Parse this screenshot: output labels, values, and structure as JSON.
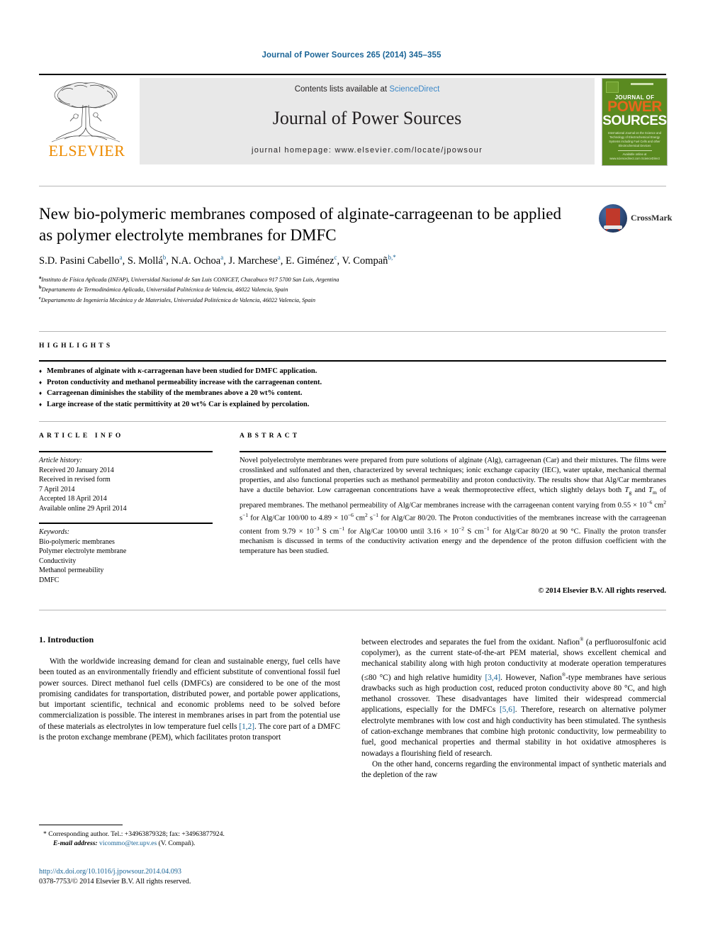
{
  "journal_ref": "Journal of Power Sources 265 (2014) 345–355",
  "masthead": {
    "contents_prefix": "Contents lists available at ",
    "sciencedirect": "ScienceDirect",
    "journal_title": "Journal of Power Sources",
    "homepage": "journal homepage: www.elsevier.com/locate/jpowsour",
    "publisher": "ELSEVIER",
    "cover": {
      "line1": "JOURNAL OF",
      "line2": "POWER",
      "line3": "SOURCES",
      "blurb": "International Journal on the Science and Technology of Electrochemical Energy Systems including Fuel Cells and other Electrochemical Devices",
      "foot": "Available online at www.sciencedirect.com ScienceDirect"
    }
  },
  "article": {
    "title": "New bio-polymeric membranes composed of alginate-carrageenan to be applied as polymer electrolyte membranes for DMFC",
    "crossmark_label": "CrossMark",
    "authors": [
      {
        "name": "S.D. Pasini Cabello",
        "marks": "a"
      },
      {
        "name": "S. Mollá",
        "marks": "b"
      },
      {
        "name": "N.A. Ochoa",
        "marks": "a"
      },
      {
        "name": "J. Marchese",
        "marks": "a"
      },
      {
        "name": "E. Giménez",
        "marks": "c"
      },
      {
        "name": "V. Compañ",
        "marks": "b,*"
      }
    ],
    "affiliations": [
      {
        "mark": "a",
        "text": "Instituto de Física Aplicada (INFAP), Universidad Nacional de San Luis CONICET, Chacabuco 917 5700 San Luis, Argentina"
      },
      {
        "mark": "b",
        "text": "Departamento de Termodinámica Aplicada, Universidad Politécnica de Valencia, 46022 Valencia, Spain"
      },
      {
        "mark": "c",
        "text": "Departamento de Ingeniería Mecánica y de Materiales, Universidad Politécnica de Valencia, 46022 Valencia, Spain"
      }
    ]
  },
  "highlights": {
    "heading": "HIGHLIGHTS",
    "items": [
      {
        "pre": "Membranes of alginate with ",
        "italic": "κ",
        "post": "-carrageenan have been studied for DMFC application."
      },
      {
        "pre": "Proton conductivity and methanol permeability increase with the carrageenan content.",
        "italic": "",
        "post": ""
      },
      {
        "pre": "Carrageenan diminishes the stability of the membranes above a 20 wt% content.",
        "italic": "",
        "post": ""
      },
      {
        "pre": "Large increase of the static permittivity at 20 wt% Car is explained by percolation.",
        "italic": "",
        "post": ""
      }
    ]
  },
  "article_info": {
    "heading": "ARTICLE INFO",
    "history_label": "Article history:",
    "history": [
      "Received 20 January 2014",
      "Received in revised form",
      "7 April 2014",
      "Accepted 18 April 2014",
      "Available online 29 April 2014"
    ],
    "keywords_label": "Keywords:",
    "keywords": [
      "Bio-polymeric membranes",
      "Polymer electrolyte membrane",
      "Conductivity",
      "Methanol permeability",
      "DMFC"
    ]
  },
  "abstract": {
    "heading": "ABSTRACT",
    "part1": "Novel polyelectrolyte membranes were prepared from pure solutions of alginate (Alg), carrageenan (Car) and their mixtures. The films were crosslinked and sulfonated and then, characterized by several techniques; ionic exchange capacity (IEC), water uptake, mechanical thermal properties, and also functional properties such as methanol permeability and proton conductivity. The results show that Alg/Car membranes have a ductile behavior. Low carrageenan concentrations have a weak thermoprotective effect, which slightly delays both ",
    "tg": "T",
    "tg_sub": "g",
    "mid1": " and ",
    "tm": "T",
    "tm_sub": "m",
    "part2": " of prepared membranes. The methanol permeability of Alg/Car membranes increase with the carrageenan content varying from 0.55 × 10",
    "exp1": "−6",
    "part3": " cm",
    "exp2": "2",
    "part4": " s",
    "exp3": "−1",
    "part5": " for Alg/Car 100/00 to 4.89 × 10",
    "exp4": "−6",
    "part6": " cm",
    "exp5": "2",
    "part7": " s",
    "exp6": "−1",
    "part8": " for Alg/Car 80/20. The Proton conductivities of the membranes increase with the carrageenan content from 9.79 × 10",
    "exp7": "−3",
    "part9": " S cm",
    "exp8": "−1",
    "part10": " for Alg/Car 100/00 until 3.16 × 10",
    "exp9": "−2",
    "part11": " S cm",
    "exp10": "−1",
    "part12": " for Alg/Car 80/20 at 90 °C. Finally the proton transfer mechanism is discussed in terms of the conductivity activation energy and the dependence of the proton diffusion coefficient with the temperature has been studied.",
    "copyright": "© 2014 Elsevier B.V. All rights reserved."
  },
  "introduction": {
    "heading": "1. Introduction",
    "left_p1_a": "With the worldwide increasing demand for clean and sustainable energy, fuel cells have been touted as an environmentally friendly and efficient substitute of conventional fossil fuel power sources. Direct methanol fuel cells (DMFCs) are considered to be one of the most promising candidates for transportation, distributed power, and portable power applications, but important scientific, technical and economic problems need to be solved before commercialization is possible. The interest in membranes arises in part from the potential use of these materials as electrolytes in low temperature fuel cells ",
    "left_ref1": "[1,2]",
    "left_p1_b": ". The core part of a DMFC is the proton exchange membrane (PEM), which facilitates proton transport",
    "right_p1_a": "between electrodes and separates the fuel from the oxidant. Nafion",
    "right_reg1": "®",
    "right_p1_b": " (a perfluorosulfonic acid copolymer), as the current state-of-the-art PEM material, shows excellent chemical and mechanical stability along with high proton conductivity at moderate operation temperatures (≤80 °C) and high relative humidity ",
    "right_ref1": "[3,4]",
    "right_p1_c": ". However, Nafion",
    "right_reg2": "®",
    "right_p1_d": "-type membranes have serious drawbacks such as high production cost, reduced proton conductivity above 80 °C, and high methanol crossover. These disadvantages have limited their widespread commercial applications, especially for the DMFCs ",
    "right_ref2": "[5,6]",
    "right_p1_e": ". Therefore, research on alternative polymer electrolyte membranes with low cost and high conductivity has been stimulated. The synthesis of cation-exchange membranes that combine high protonic conductivity, low permeability to fuel, good mechanical properties and thermal stability in hot oxidative atmospheres is nowadays a flourishing field of research.",
    "right_p2": "On the other hand, concerns regarding the environmental impact of synthetic materials and the depletion of the raw"
  },
  "footer": {
    "corresponding": "* Corresponding author. Tel.: +34963879328; fax: +34963877924.",
    "email_label": "E-mail address:",
    "email": "vicommo@ter.upv.es",
    "email_suffix": " (V. Compañ).",
    "doi": "http://dx.doi.org/10.1016/j.jpowsour.2014.04.093",
    "issn": "0378-7753/© 2014 Elsevier B.V. All rights reserved."
  },
  "colors": {
    "link": "#1a6496",
    "sciencedirect": "#3a87c8",
    "elsevier_orange": "#ED8B00",
    "cover_green": "#5a8a20"
  }
}
